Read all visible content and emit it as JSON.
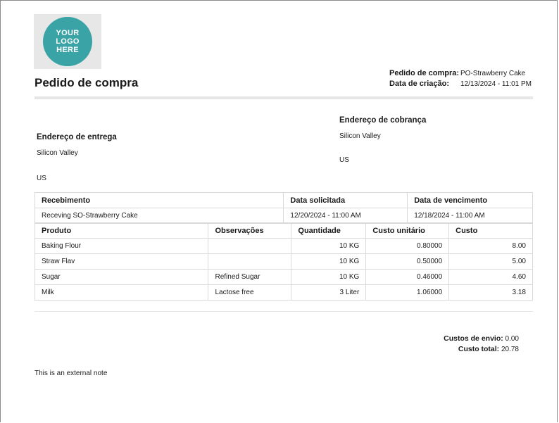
{
  "logo": {
    "text": "YOUR\nLOGO\nHERE"
  },
  "document": {
    "title": "Pedido de compra"
  },
  "meta": {
    "order_label": "Pedido de compra:",
    "order_value": "PO-Strawberry Cake",
    "created_label": "Data de criação:",
    "created_value": "12/13/2024 - 11:01 PM"
  },
  "shipping": {
    "heading": "Endereço de entrega",
    "line1": "Silicon Valley",
    "country": "US"
  },
  "billing": {
    "heading": "Endereço de cobrança",
    "line1": "Silicon Valley",
    "country": "US"
  },
  "receipt_table": {
    "headers": [
      "Recebimento",
      "Data solicitada",
      "Data de vencimento"
    ],
    "row": [
      "Receving SO-Strawberry Cake",
      "12/20/2024 - 11:00 AM",
      "12/18/2024 - 11:00 AM"
    ]
  },
  "items_table": {
    "headers": [
      "Produto",
      "Observações",
      "Quantidade",
      "Custo unitário",
      "Custo"
    ],
    "rows": [
      [
        "Baking Flour",
        "",
        "10 KG",
        "0.80000",
        "8.00"
      ],
      [
        "Straw Flav",
        "",
        "10 KG",
        "0.50000",
        "5.00"
      ],
      [
        "Sugar",
        "Refined Sugar",
        "10 KG",
        "0.46000",
        "4.60"
      ],
      [
        "Milk",
        "Lactose free",
        "3 Liter",
        "1.06000",
        "3.18"
      ]
    ]
  },
  "totals": {
    "shipping_label": "Custos de envio:",
    "shipping_value": "0.00",
    "total_label": "Custo total:",
    "total_value": "20.78"
  },
  "note": "This is an external note"
}
